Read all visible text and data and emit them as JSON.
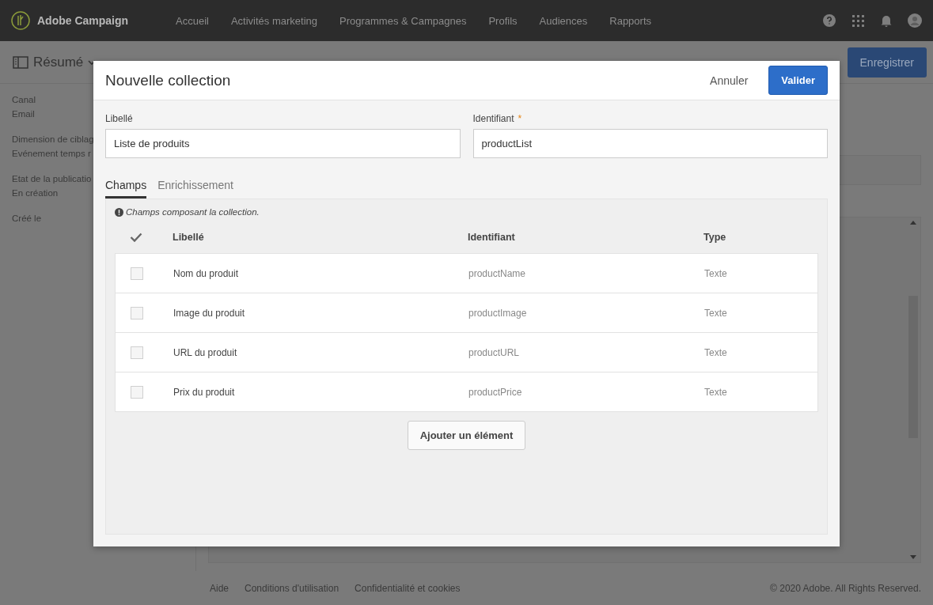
{
  "app": {
    "name": "Adobe Campaign"
  },
  "nav": [
    {
      "label": "Accueil"
    },
    {
      "label": "Activités marketing"
    },
    {
      "label": "Programmes & Campagnes"
    },
    {
      "label": "Profils"
    },
    {
      "label": "Audiences"
    },
    {
      "label": "Rapports"
    }
  ],
  "page_header": {
    "title": "Résumé",
    "save_button": "Enregistrer"
  },
  "summary": [
    {
      "label": "Canal",
      "value": "Email"
    },
    {
      "label": "Dimension de ciblag",
      "value": "Evénement temps r"
    },
    {
      "label": "Etat de la publicatio",
      "value": "En création"
    },
    {
      "label": "Créé le"
    }
  ],
  "modal": {
    "title": "Nouvelle collection",
    "cancel": "Annuler",
    "confirm": "Valider",
    "required_mark": "*",
    "fields": [
      {
        "label": "Libellé",
        "value": "Liste de produits",
        "required": false
      },
      {
        "label": "Identifiant",
        "value": "productList",
        "required": true
      }
    ],
    "tabs": [
      {
        "label": "Champs",
        "selected": true
      },
      {
        "label": "Enrichissement",
        "selected": false
      }
    ],
    "info": "Champs composant la collection.",
    "table": {
      "columns": [
        "Libellé",
        "Identifiant",
        "Type"
      ],
      "rows": [
        {
          "label": "Nom du produit",
          "identifier": "productName",
          "type": "Texte",
          "checked": false
        },
        {
          "label": "Image du produit",
          "identifier": "productImage",
          "type": "Texte",
          "checked": false
        },
        {
          "label": "URL du produit",
          "identifier": "productURL",
          "type": "Texte",
          "checked": false
        },
        {
          "label": "Prix du produit",
          "identifier": "productPrice",
          "type": "Texte",
          "checked": false
        }
      ]
    },
    "add_button": "Ajouter un élément"
  },
  "footer": {
    "links": [
      "Aide",
      "Conditions d'utilisation",
      "Confidentialité et cookies"
    ],
    "copyright": "© 2020 Adobe. All Rights Reserved."
  }
}
